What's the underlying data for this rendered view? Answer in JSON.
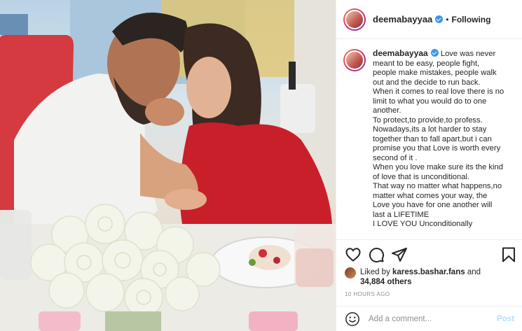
{
  "post": {
    "username": "deemabayyaa",
    "follow_status": "Following",
    "separator": "•"
  },
  "caption": {
    "username": "deemabayyaa",
    "lines": [
      "Love was never",
      "meant to be easy, people fight,",
      "people make mistakes, people walk",
      "out and the decide to run back.",
      "When it comes to real love there is no",
      "limit to what you would do to one",
      "another.",
      "To protect,to provide,to profess.",
      "Nowadays,its a lot harder to stay",
      "together than to fall apart,but i can",
      "promise you that Love is worth every",
      "second of it .",
      "When you love make sure its the kind",
      "of love that is unconditional.",
      "That way no matter what happens,no",
      "matter what comes your way, the",
      "Love you have for one another will",
      "last a LIFETIME",
      "I LOVE YOU Unconditionally"
    ]
  },
  "actions": {
    "like_icon": "heart-icon",
    "comment_icon": "comment-icon",
    "share_icon": "share-icon",
    "save_icon": "bookmark-icon"
  },
  "likes": {
    "prefix": "Liked by",
    "liker": "karess.bashar.fans",
    "joiner": "and",
    "others": "34,884 others"
  },
  "timestamp": "10 HOURS AGO",
  "comment": {
    "placeholder": "Add a comment...",
    "post_label": "Post",
    "emoji_icon": "smiley-icon"
  },
  "colors": {
    "verified": "#3897f0",
    "muted": "#8e8e8e",
    "post_disabled": "#b2dffc",
    "text": "#262626"
  }
}
